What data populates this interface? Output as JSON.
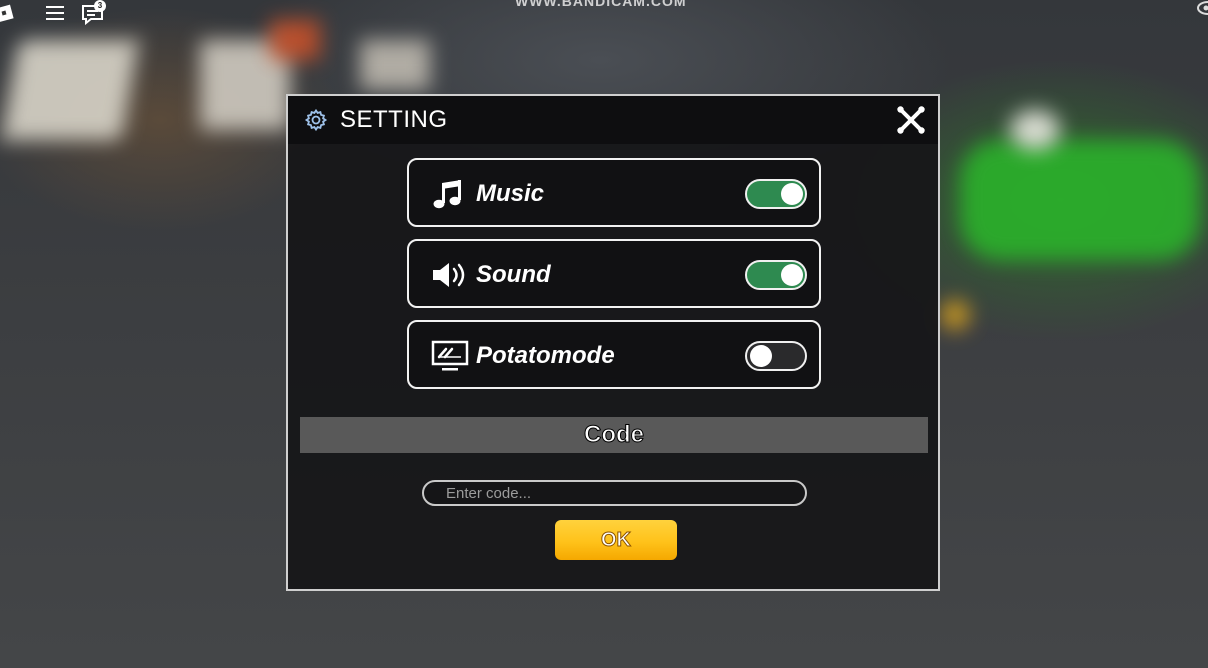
{
  "watermark": "WWW.BANDICAM.COM",
  "chat_badge_count": "3",
  "settings": {
    "title": "SETTING",
    "rows": [
      {
        "label": "Music",
        "icon": "music-note-icon",
        "enabled": true
      },
      {
        "label": "Sound",
        "icon": "speaker-icon",
        "enabled": true
      },
      {
        "label": "Potatomode",
        "icon": "monitor-icon",
        "enabled": false
      }
    ],
    "code": {
      "heading": "Code",
      "placeholder": "Enter code...",
      "button_label": "OK"
    }
  },
  "colors": {
    "toggle_on": "#2e8a50",
    "ok_button": "#ffc21a"
  }
}
